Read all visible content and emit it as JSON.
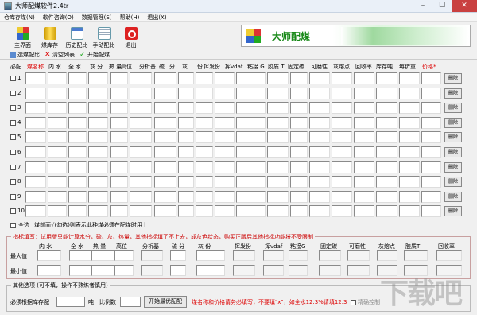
{
  "window": {
    "title": "大师配煤软件2.4tr"
  },
  "menu": [
    "仓库存煤(N)",
    "软件咨询(O)",
    "数据管理(S)",
    "帮助(H)",
    "退出(X)"
  ],
  "toolbar": [
    {
      "label": "主界面",
      "icon": "main-grid-icon"
    },
    {
      "label": "煤库存",
      "icon": "coal-stock-icon"
    },
    {
      "label": "历史配比",
      "icon": "history-calendar-icon"
    },
    {
      "label": "手动配比",
      "icon": "manual-doc-icon"
    },
    {
      "label": "退出",
      "icon": "exit-power-icon"
    }
  ],
  "banner": {
    "text": "大师配煤"
  },
  "subbar": {
    "select": "选煤配比",
    "clear": "清空列表",
    "start": "开始配煤"
  },
  "header": [
    "必配",
    "煤名称",
    "内 水",
    "全 水",
    "灰 分",
    "热 量",
    "高位",
    "分析基",
    "硫",
    "分",
    "灰",
    "份",
    "挥发份",
    "挥vdaf",
    "粘接 G",
    "胶质 T",
    "固定碳",
    "可磨性",
    "灰熔点",
    "回收率",
    "库存吨",
    "每铲重",
    "价格*"
  ],
  "rows": [
    "1",
    "2",
    "3",
    "4",
    "5",
    "6",
    "7",
    "8",
    "9",
    "10"
  ],
  "row_action": "删除",
  "all_row": {
    "label": "全选",
    "note": "煤前面√(勾选)则表示此种煤必须在配煤时用上"
  },
  "limits": {
    "title": "指标填写：试用版只能计算水分，硫、灰、热量，其他指标填了不上去，成灰色状态，购买正版后其他指标功能将不受限制",
    "headers": [
      "内 水",
      "全 水",
      "热 量",
      "高位",
      "分析基",
      "硫 分",
      "灰 份",
      "挥发份",
      "挥vdaf",
      "粘接G",
      "固定碳",
      "可磨性",
      "灰熔点",
      "胶质T",
      "回收率"
    ],
    "max_label": "最大值",
    "min_label": "最小值"
  },
  "bottom": {
    "title": "其他选项 (可不填，操作不熟练者慎用)",
    "stock_label": "必须根据库存配",
    "ton_label": "吨",
    "ratio_label": "比例数",
    "start_button": "开始最优配配",
    "note": "煤名称和价格请务必填写，不要填\"x\"，如全水12.3%请填12.3",
    "lock_label": "精确控制"
  },
  "watermark": "下载吧"
}
